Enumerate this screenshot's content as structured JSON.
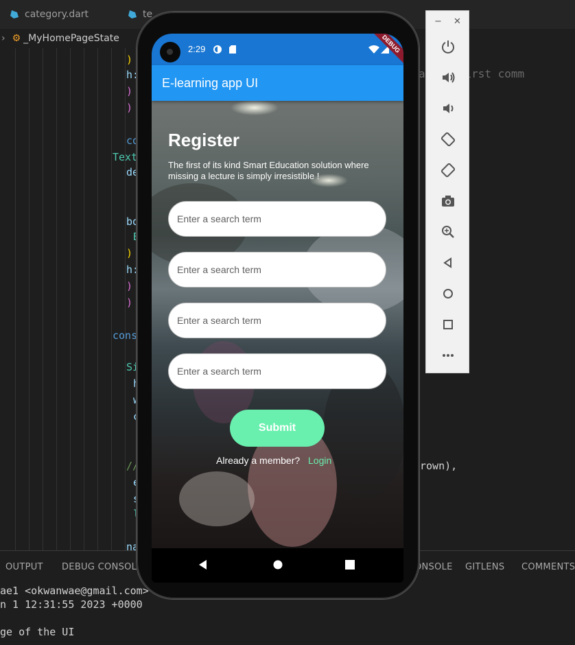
{
  "editor": {
    "tabs": [
      {
        "label": "category.dart"
      },
      {
        "label": "te"
      }
    ],
    "breadcrumb": {
      "class_name": "_MyHomePageState"
    },
    "code_fragments": [
      {
        "text": ")",
        "color": "#ffd700"
      },
      {
        "text": "h:",
        "color": "#9cdcfe"
      },
      {
        "text": ")",
        "color": "#da70d6"
      },
      {
        "text": ")",
        "color": "#da70d6"
      },
      {
        "text": "co",
        "color": "#569cd6"
      },
      {
        "text": "Text",
        "color": "#4ec9b0"
      },
      {
        "text": "de",
        "color": "#9cdcfe"
      },
      {
        "text": "bo",
        "color": "#9cdcfe"
      },
      {
        "text": "B",
        "color": "#4ec9b0"
      },
      {
        "text": ")",
        "color": "#ffd700"
      },
      {
        "text": "h:",
        "color": "#9cdcfe"
      },
      {
        "text": ")",
        "color": "#da70d6"
      },
      {
        "text": ")",
        "color": "#da70d6"
      },
      {
        "text": "cons",
        "color": "#569cd6"
      },
      {
        "text": "Si",
        "color": "#4ec9b0"
      },
      {
        "text": "h",
        "color": "#9cdcfe"
      },
      {
        "text": "w",
        "color": "#9cdcfe"
      },
      {
        "text": "c",
        "color": "#9cdcfe"
      },
      {
        "text": "//",
        "color": "#6a9955"
      },
      {
        "text": "e",
        "color": "#9cdcfe"
      },
      {
        "text": "s",
        "color": "#9cdcfe"
      },
      {
        "text": "l",
        "color": "#4ec9b0"
      },
      {
        "text": "na",
        "color": "#9cdcfe"
      },
      {
        "text": "rown),",
        "color": "#6a9955"
      }
    ],
    "blame": "ago • first comm"
  },
  "panel": {
    "tabs": [
      "OUTPUT",
      "DEBUG CONSOLE",
      "ONSOLE",
      "GITLENS",
      "COMMENTS"
    ],
    "terminal_lines": [
      "ae1 <okwanwae@gmail.com>",
      "n 1 12:31:55 2023 +0000",
      "",
      "ge of the UI"
    ]
  },
  "emulator": {
    "window_controls": {
      "minimize": "−",
      "close": "✕"
    },
    "tools": [
      "power-icon",
      "volume-up-icon",
      "volume-down-icon",
      "rotate-left-icon",
      "rotate-right-icon",
      "camera-icon",
      "zoom-icon",
      "back-icon",
      "home-icon",
      "overview-icon",
      "more-icon"
    ]
  },
  "phone": {
    "status": {
      "time": "2:29",
      "debug_banner": "DEBUG"
    },
    "app_bar_title": "E-learning app UI",
    "register": {
      "title": "Register",
      "subtitle": "The first of its kind Smart Education solution where missing a lecture is simply irresistible !",
      "fields": [
        {
          "placeholder": "Enter a search term"
        },
        {
          "placeholder": "Enter a search term"
        },
        {
          "placeholder": "Enter a search term"
        },
        {
          "placeholder": "Enter a search term"
        }
      ],
      "submit_label": "Submit",
      "already_text": "Already a member?",
      "login_label": "Login"
    },
    "colors": {
      "app_bar": "#2196f3",
      "status_bar": "#1976d2",
      "accent": "#69f0ae"
    }
  }
}
